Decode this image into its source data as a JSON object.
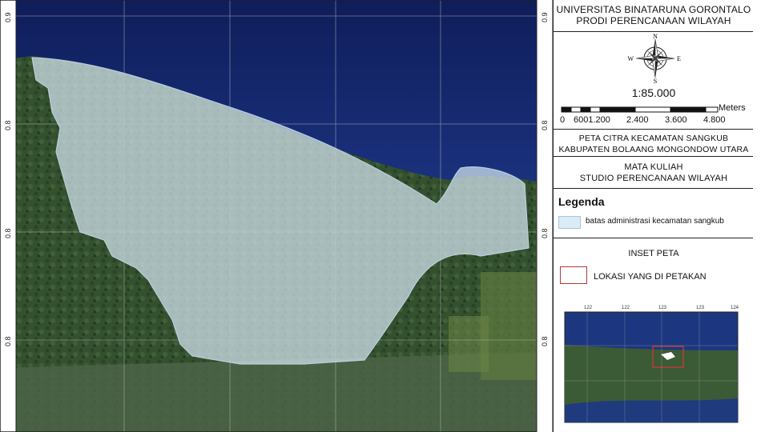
{
  "header": {
    "university": "UNIVERSITAS BINATARUNA GORONTALO",
    "program": "PRODI PERENCANAAN WILAYAH"
  },
  "north_arrow": {
    "n": "N",
    "s": "S",
    "e": "E",
    "w": "W"
  },
  "scale": {
    "ratio": "1:85.000",
    "unit": "Meters",
    "ticks": [
      "0",
      "6001.200",
      "2.400",
      "3.600",
      "4.800"
    ]
  },
  "map_title": {
    "line1": "PETA CITRA KECAMATAN SANGKUB",
    "line2": "KABUPATEN BOLAANG MONGONDOW UTARA"
  },
  "course": {
    "line1": "MATA KULIAH",
    "line2": "STUDIO PERENCANAAN WILAYAH"
  },
  "legend": {
    "title": "Legenda",
    "items": [
      {
        "label": "batas administrasi kecamatan sangkub",
        "color": "#d9ecf7"
      }
    ]
  },
  "inset": {
    "title": "INSET PETA",
    "location_label": "LOKASI YANG DI PETAKAN",
    "location_color": "#b43a3a",
    "top_ticks": [
      "122",
      "122",
      "123",
      "123",
      "124"
    ]
  },
  "map_coords": {
    "left_ticks": [
      "0.9",
      "0.8",
      "0.8",
      "0.8"
    ],
    "right_ticks": [
      "0.9",
      "0.8",
      "0.8",
      "0.8"
    ]
  },
  "colors": {
    "sea": "#16286b",
    "land": "#3d5a35",
    "admin_fill": "#cfe3ef",
    "frame": "#222222"
  }
}
